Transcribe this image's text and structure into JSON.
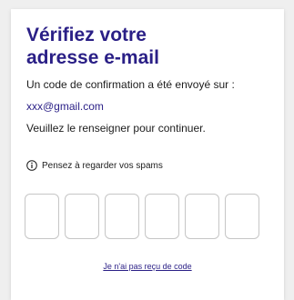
{
  "verify": {
    "title": "Vérifiez votre adresse e-mail",
    "message": "Un code de confirmation a été envoyé sur :",
    "email": "xxx@gmail.com",
    "instruction": "Veuillez le renseigner pour continuer.",
    "spam_hint": "Pensez à regarder vos spams",
    "code_digits": [
      "",
      "",
      "",
      "",
      "",
      ""
    ],
    "resend_link": "Je n'ai pas reçu de code"
  },
  "colors": {
    "accent": "#2a1f86",
    "box_border": "#c6c6c6",
    "background": "#efefef"
  },
  "icons": {
    "hint": "info-icon"
  }
}
